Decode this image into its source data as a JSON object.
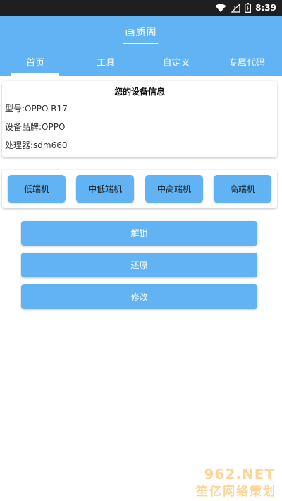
{
  "status_bar": {
    "time": "8:39",
    "icons": [
      "wifi-icon",
      "signal-icon",
      "battery-icon"
    ]
  },
  "app": {
    "title": "画质阁"
  },
  "tabs": [
    {
      "label": "首页",
      "active": true
    },
    {
      "label": "工具",
      "active": false
    },
    {
      "label": "自定义",
      "active": false
    },
    {
      "label": "专属代码",
      "active": false
    }
  ],
  "device_info": {
    "title": "您的设备信息",
    "model": "型号:OPPO R17",
    "brand": "设备品牌:OPPO",
    "processor": "处理器:sdm660"
  },
  "tiers": [
    "低端机",
    "中低端机",
    "中高端机",
    "高端机"
  ],
  "actions": {
    "unlock": "解锁",
    "restore": "还原",
    "modify": "修改"
  },
  "watermark": {
    "top": "962.NET",
    "bottom": "笙亿网络策划"
  },
  "colors": {
    "accent": "#61b3f3",
    "status_bar": "#1f1f1f"
  }
}
